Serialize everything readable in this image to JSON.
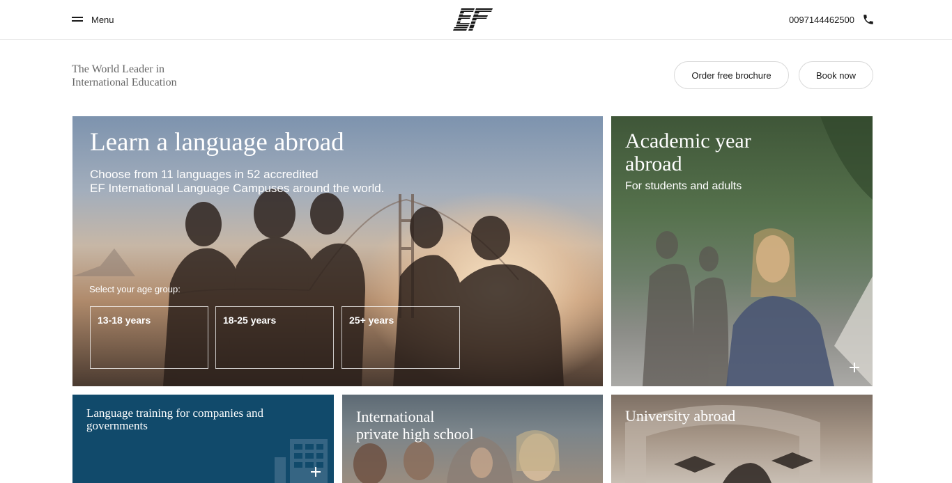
{
  "header": {
    "menu_label": "Menu",
    "phone_number": "0097144462500",
    "icons": {
      "menu": "hamburger-icon",
      "phone": "phone-icon",
      "logo": "ef-logo"
    }
  },
  "intro": {
    "tagline_line1": "The World Leader in",
    "tagline_line2": "International Education",
    "brochure_button": "Order free brochure",
    "book_button": "Book now"
  },
  "cards": {
    "language": {
      "title": "Learn a language abroad",
      "subtitle_line1": "Choose from 11 languages in 52 accredited",
      "subtitle_line2": "EF International Language Campuses around the world.",
      "age_label": "Select your age group:",
      "age_groups": [
        "13-18 years",
        "18-25 years",
        "25+ years"
      ]
    },
    "academic": {
      "title_line1": "Academic year",
      "title_line2": "abroad",
      "subtitle": "For students and adults"
    },
    "corporate": {
      "title": "Language training for companies and governments"
    },
    "school": {
      "title_line1": "International",
      "title_line2": "private high school"
    },
    "university": {
      "title": "University abroad"
    }
  },
  "colors": {
    "corporate_card": "#114a6b",
    "text_primary": "#191919",
    "tagline": "#666666",
    "pill_border": "#d9d9d9"
  }
}
